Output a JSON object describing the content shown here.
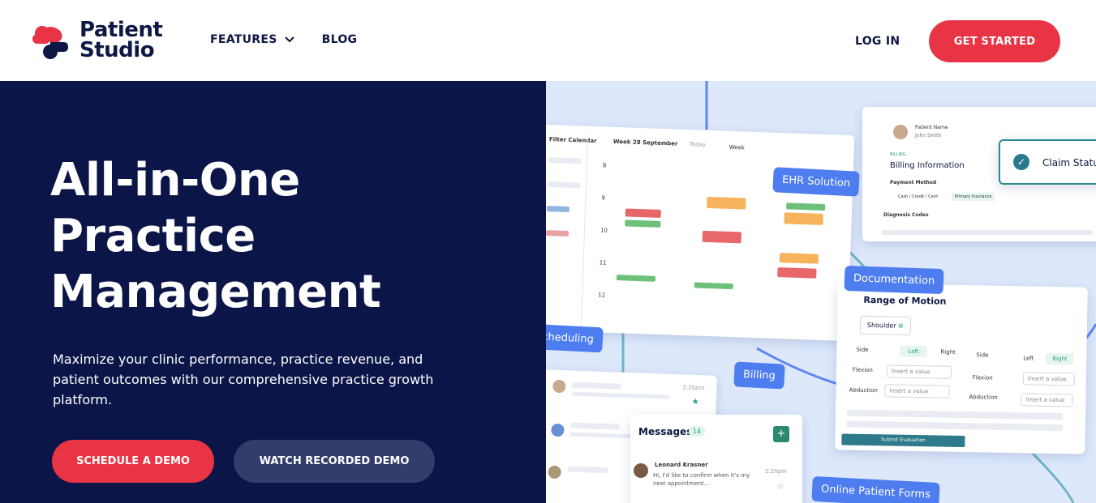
{
  "brand": {
    "name_line1": "Patient",
    "name_line2": "Studio"
  },
  "nav": {
    "features": "FEATURES",
    "blog": "BLOG",
    "login": "LOG IN",
    "get_started": "GET STARTED"
  },
  "hero": {
    "title_line1": "All-in-One",
    "title_line2": "Practice",
    "title_line3": "Management",
    "description": "Maximize your clinic performance, practice revenue, and patient outcomes with our comprehensive practice growth platform.",
    "schedule_demo": "SCHEDULE A DEMO",
    "watch_demo": "WATCH RECORDED DEMO"
  },
  "visual": {
    "tags": {
      "ehr": "EHR Solution",
      "scheduling": "Scheduling",
      "billing": "Billing",
      "documentation": "Documentation",
      "forms": "Online Patient Forms"
    },
    "calendar": {
      "filter_title": "Filter Calendar",
      "week_label": "Week 28 September",
      "today": "Today",
      "week": "Week",
      "hours": [
        "8",
        "9",
        "10",
        "11",
        "12"
      ]
    },
    "billing_card": {
      "patient_name_label": "Patient Name",
      "patient_name": "John Smith",
      "section": "BILLING",
      "title": "Billing Information",
      "payment_method": "Payment Method",
      "option_cash": "Cash / Credit / Card",
      "option_insurance": "Primary Insurance",
      "diagnosis": "Diagnosis Codes",
      "claim_status": "Claim Status"
    },
    "rom_card": {
      "title": "Range of Motion",
      "joint": "Shoulder",
      "side": "Side",
      "left": "Left",
      "right": "Right",
      "flexion": "Flexion",
      "abduction": "Abduction",
      "placeholder": "Insert a value",
      "submit": "Submit Evaluation"
    },
    "messages": {
      "title": "Messages",
      "count": "14",
      "sender": "Leonard Krasner",
      "time": "2:20pm",
      "preview": "Hi, I'd like to confirm when it's my next appointment...",
      "list_time": "2:20pm"
    }
  },
  "colors": {
    "navy": "#0c1547",
    "red": "#e83444",
    "blue_tag": "#4e7df0",
    "light_bg": "#dde8fb"
  }
}
